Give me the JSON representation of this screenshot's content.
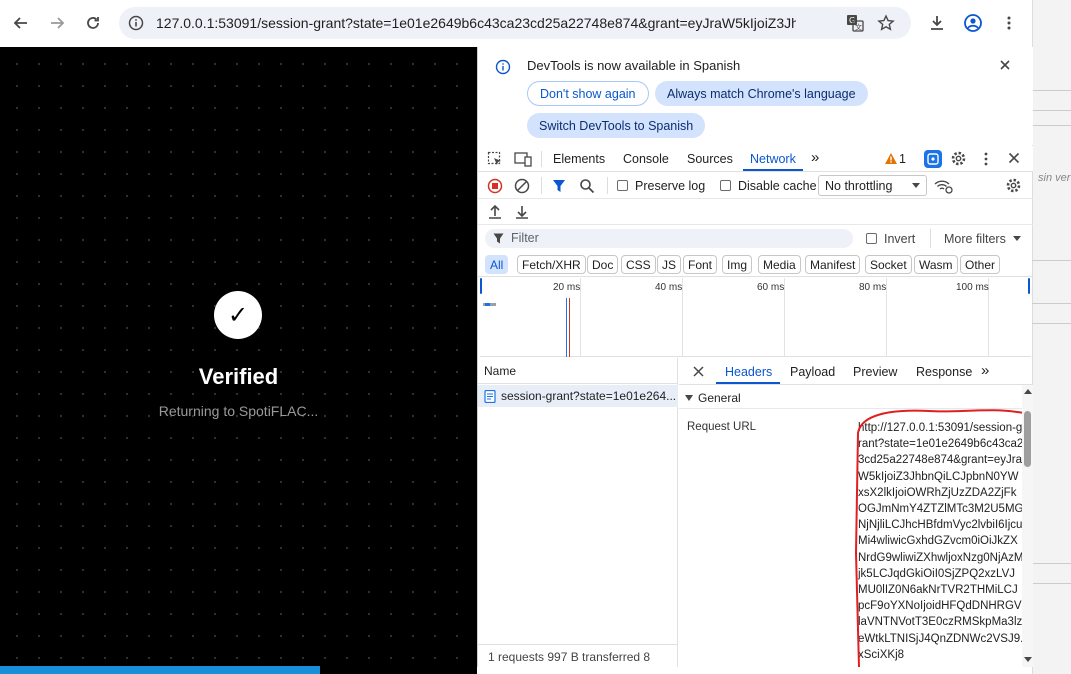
{
  "browser": {
    "url": "127.0.0.1:53091/session-grant?state=1e01e2649b6c43ca23cd25a22748e874&grant=eyJraW5kIjoiZ3JhbnQiL..."
  },
  "page": {
    "title": "Verified",
    "subtitle": "Returning to SpotiFLAC..."
  },
  "background_page": {
    "text": "sin ver"
  },
  "devtools": {
    "infobar": {
      "message": "DevTools is now available in Spanish",
      "btn_dont_show": "Don't show again",
      "btn_always_match": "Always match Chrome's language",
      "btn_switch": "Switch DevTools to Spanish"
    },
    "tabs": [
      "Elements",
      "Console",
      "Sources",
      "Network"
    ],
    "more_tabs": "»",
    "warning_count": "1",
    "network": {
      "preserve_log": "Preserve log",
      "disable_cache": "Disable cache",
      "throttling": "No throttling",
      "filter_placeholder": "Filter",
      "invert": "Invert",
      "more_filters": "More filters",
      "chips": [
        "All",
        "Fetch/XHR",
        "Doc",
        "CSS",
        "JS",
        "Font",
        "Img",
        "Media",
        "Manifest",
        "Socket",
        "Wasm",
        "Other"
      ],
      "timeline_ticks": [
        "20 ms",
        "40 ms",
        "60 ms",
        "80 ms",
        "100 ms"
      ],
      "name_header": "Name",
      "request_name": "session-grant?state=1e01e264...",
      "status": "1 requests   997 B transferred   8"
    },
    "details": {
      "tabs": [
        "Headers",
        "Payload",
        "Preview",
        "Response"
      ],
      "more": "»",
      "section": "General",
      "request_url_label": "Request URL",
      "request_url_value": "http://127.0.0.1:53091/session-grant?state=1e01e2649b6c43ca23cd25a22748e874&grant=eyJraW5kIjoiZ3JhbnQiLCJpbnN0YWxsX2lkIjoiOWRhZjUzZDA2ZjFkOGJmNmY4ZTZlMTc3M2U5MGNjNjliLCJhcHBfdmVyc2lvbiI6IjcuMi4wliwicGxhdGZvcm0iOiJkZXNrdG9wliwiZXhwljoxNzg0NjAzMjk5LCJqdGkiOiI0SjZPQ2xzLVJMU0lIZ0N6akNrTVR2THMiLCJpcF9oYXNoIjoidHFQdDNHRGVlaVNTNVotT3E0czRMSkpMa3lzeWtkLTNISjJ4QnZDNWc2VSJ9.xSciXKj8"
    }
  }
}
